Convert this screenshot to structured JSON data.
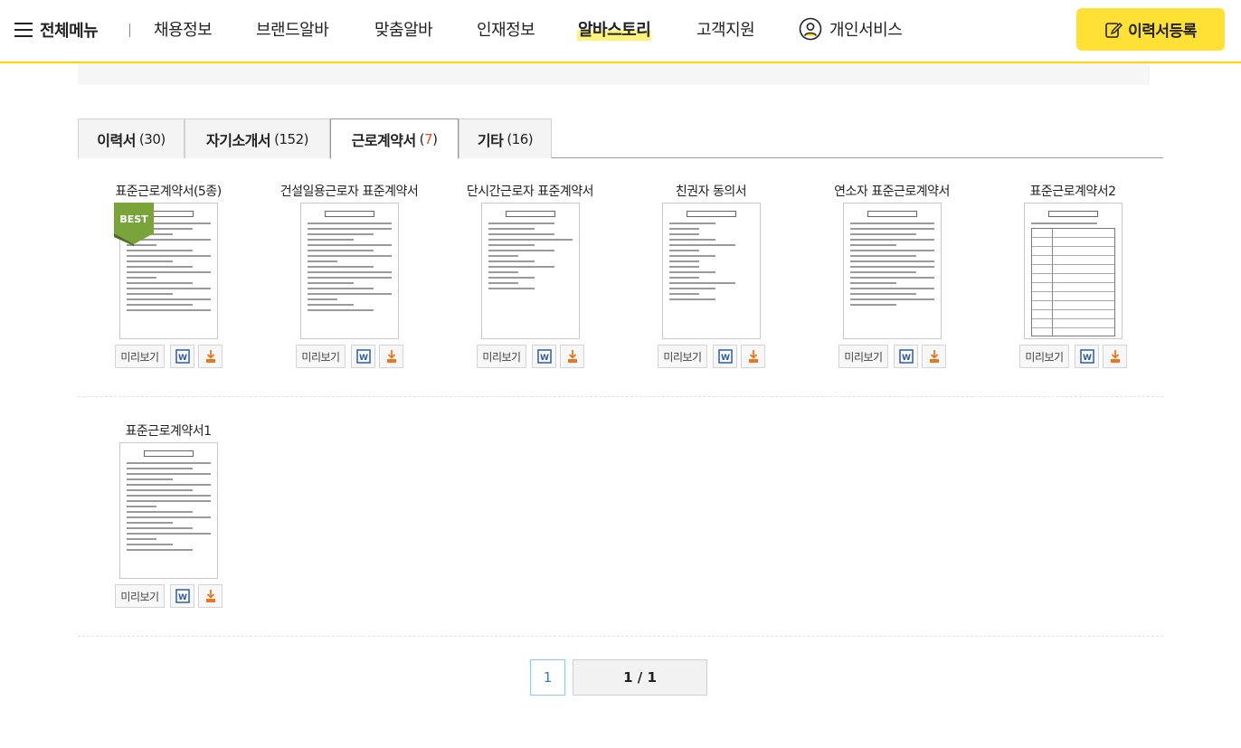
{
  "header": {
    "menu_label": "전체메뉴",
    "nav": [
      "채용정보",
      "브랜드알바",
      "맞춤알바",
      "인재정보",
      "알바스토리",
      "고객지원"
    ],
    "active_nav": "알바스토리",
    "personal_service": "개인서비스",
    "cta_label": "이력서등록"
  },
  "tabs": [
    {
      "label": "이력서",
      "count": "30"
    },
    {
      "label": "자기소개서",
      "count": "152"
    },
    {
      "label": "근로계약서",
      "count": "7",
      "active": true
    },
    {
      "label": "기타",
      "count": "16"
    }
  ],
  "cards": [
    {
      "title": "표준근로계약서(5종)",
      "badge": "BEST"
    },
    {
      "title": "건설일용근로자 표준계약서"
    },
    {
      "title": "단시간근로자 표준계약서"
    },
    {
      "title": "친권자 동의서"
    },
    {
      "title": "연소자 표준근로계약서"
    },
    {
      "title": "표준근로계약서2"
    },
    {
      "title": "표준근로계약서1"
    }
  ],
  "card_actions": {
    "preview_label": "미리보기",
    "word_icon": "word-icon",
    "download_icon": "download-icon"
  },
  "pagination": {
    "current": "1",
    "summary": "1 / 1"
  },
  "colors": {
    "accent_yellow": "#ffe034",
    "header_border": "#ffd400",
    "active_count": "#e8501e",
    "page_blue": "#2a7fd4"
  }
}
